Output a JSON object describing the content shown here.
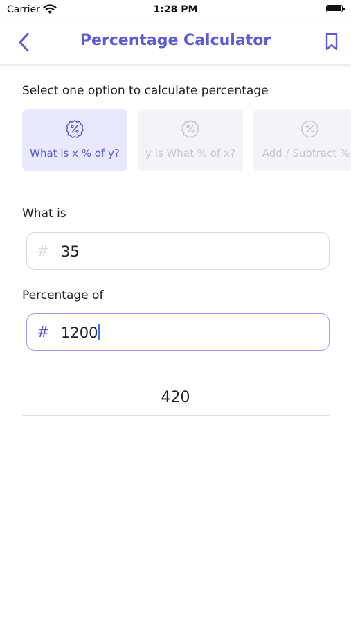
{
  "status_bar": {
    "carrier": "Carrier",
    "time": "1:28 PM"
  },
  "nav": {
    "title": "Percentage Calculator",
    "back_icon": "chevron-left-icon",
    "bookmark_icon": "bookmark-icon"
  },
  "prompt": "Select one option to calculate percentage",
  "options": [
    {
      "label": "What is x % of y?",
      "icon": "percent-badge-icon",
      "selected": true
    },
    {
      "label": "y is What % of x?",
      "icon": "percent-badge-icon",
      "selected": false
    },
    {
      "label": "Add / Subtract %",
      "icon": "plus-minus-percent-icon",
      "selected": false
    }
  ],
  "fields": [
    {
      "label": "What is",
      "value": "35"
    },
    {
      "label": "Percentage of",
      "value": "1200"
    }
  ],
  "result": "420",
  "colors": {
    "accent": "#5B5BD6",
    "accent_bg": "#E8E9FC",
    "inactive_bg": "#F4F4F6",
    "inactive_text": "#C6C6CC"
  }
}
